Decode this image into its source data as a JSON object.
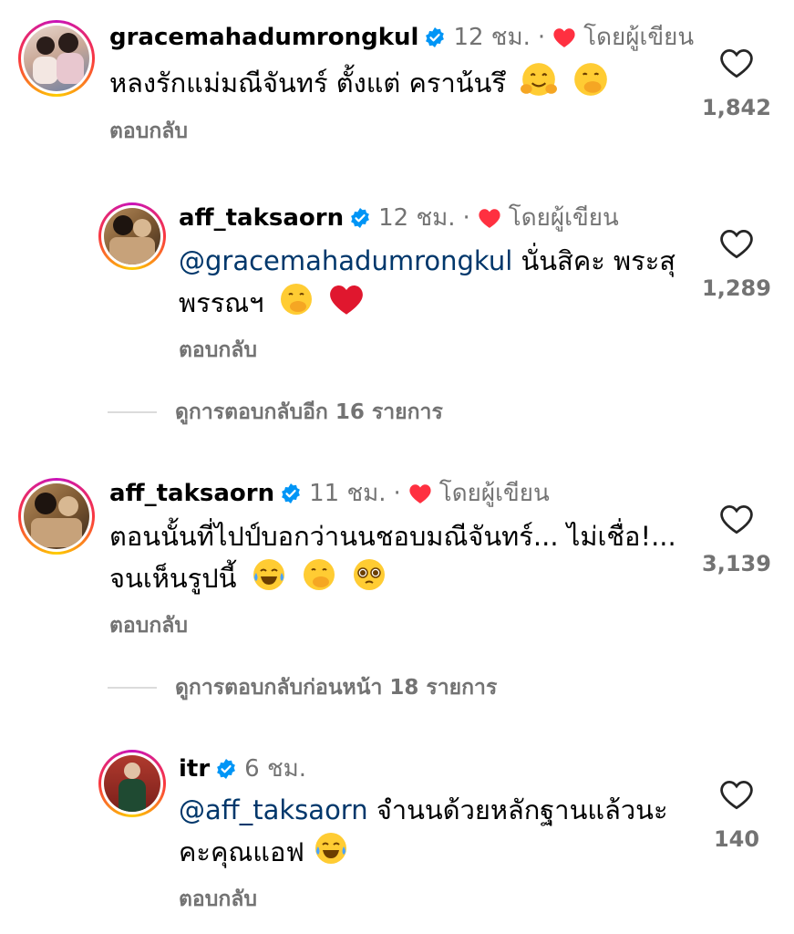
{
  "comments": [
    {
      "username": "gracemahadumrongkul",
      "time": "12 ชม.",
      "dot": "·",
      "author_label": "โดยผู้เขียน",
      "text": "หลงรักแม่มณีจันทร์ ตั้งแต่ คราน้นรึ",
      "reply_label": "ตอบกลับ",
      "like_count": "1,842"
    },
    {
      "username": "aff_taksaorn",
      "time": "12 ชม.",
      "dot": "·",
      "author_label": "โดยผู้เขียน",
      "mention": "@gracemahadumrongkul",
      "text_line1": "นั่นสิคะ พระสุ",
      "text_line2": "พรรณฯ",
      "reply_label": "ตอบกลับ",
      "like_count": "1,289"
    },
    {
      "username": "aff_taksaorn",
      "time": "11 ชม.",
      "dot": "·",
      "author_label": "โดยผู้เขียน",
      "text_line1": "ตอนนั้นที่ไปป์บอกว่านนชอบมณีจันทร์... ไม่เชื่อ!...",
      "text_line2": "จนเห็นรูปนี้",
      "reply_label": "ตอบกลับ",
      "like_count": "3,139"
    },
    {
      "username": "itr",
      "time": "6 ชม.",
      "mention": "@aff_taksaorn",
      "text_line1": "จำนนด้วยหลักฐานแล้วนะ",
      "text_line2": "คะคุณแอฟ",
      "reply_label": "ตอบกลับ",
      "like_count": "140"
    }
  ],
  "threads": {
    "more_replies": "ดูการตอบกลับอีก 16 รายการ",
    "previous_replies": "ดูการตอบกลับก่อนหน้า 18 รายการ"
  },
  "icons": {
    "verified": "verified-badge-icon",
    "author_heart": "heart-filled-icon",
    "like": "heart-outline-icon"
  },
  "colors": {
    "verified_blue": "#0095f6",
    "heart_red": "#ff3040",
    "secondary_text": "#737373",
    "mention": "#00376b"
  }
}
